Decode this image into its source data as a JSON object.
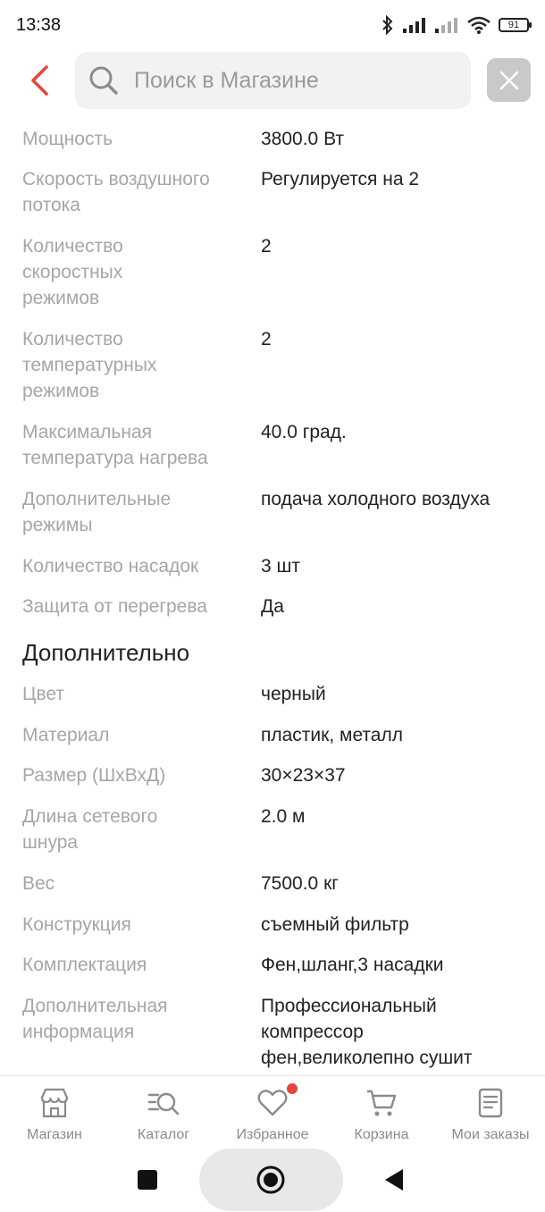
{
  "status_bar": {
    "time": "13:38",
    "battery": "91"
  },
  "search": {
    "placeholder": "Поиск в Магазине"
  },
  "specs": [
    {
      "label": "Мощность",
      "value": "3800.0 Вт"
    },
    {
      "label": "Скорость воздушного потока",
      "value": "Регулируется на 2"
    },
    {
      "label": "Количество скоростных режимов",
      "value": "2"
    },
    {
      "label": "Количество температурных режимов",
      "value": "2"
    },
    {
      "label": "Максимальная температура нагрева",
      "value": "40.0 град."
    },
    {
      "label": "Дополнительные режимы",
      "value": "подача холодного воздуха"
    },
    {
      "label": "Количество насадок",
      "value": "3 шт"
    },
    {
      "label": "Защита от перегрева",
      "value": "Да"
    }
  ],
  "extra_section": {
    "title": "Дополнительно",
    "items": [
      {
        "label": "Цвет",
        "value": "черный"
      },
      {
        "label": "Материал",
        "value": "пластик, металл"
      },
      {
        "label": "Размер (ШхВхД)",
        "value": "30×23×37"
      },
      {
        "label": "Длина сетевого шнура",
        "value": "2.0 м"
      },
      {
        "label": "Вес",
        "value": "7500.0 кг"
      },
      {
        "label": "Конструкция",
        "value": "съемный фильтр"
      },
      {
        "label": "Комплектация",
        "value": "Фен,шланг,3 насадки"
      },
      {
        "label": "Дополнительная информация",
        "value": "Профессиональный компрессор фен,великолепно сушит"
      }
    ]
  },
  "bottom_nav": [
    {
      "label": "Магазин",
      "icon": "store-icon"
    },
    {
      "label": "Каталог",
      "icon": "catalog-search-icon"
    },
    {
      "label": "Избранное",
      "icon": "heart-icon"
    },
    {
      "label": "Корзина",
      "icon": "cart-icon"
    },
    {
      "label": "Мои заказы",
      "icon": "orders-icon"
    }
  ],
  "colors": {
    "accent": "#e8443b",
    "label_gray": "#a6a6a6"
  }
}
